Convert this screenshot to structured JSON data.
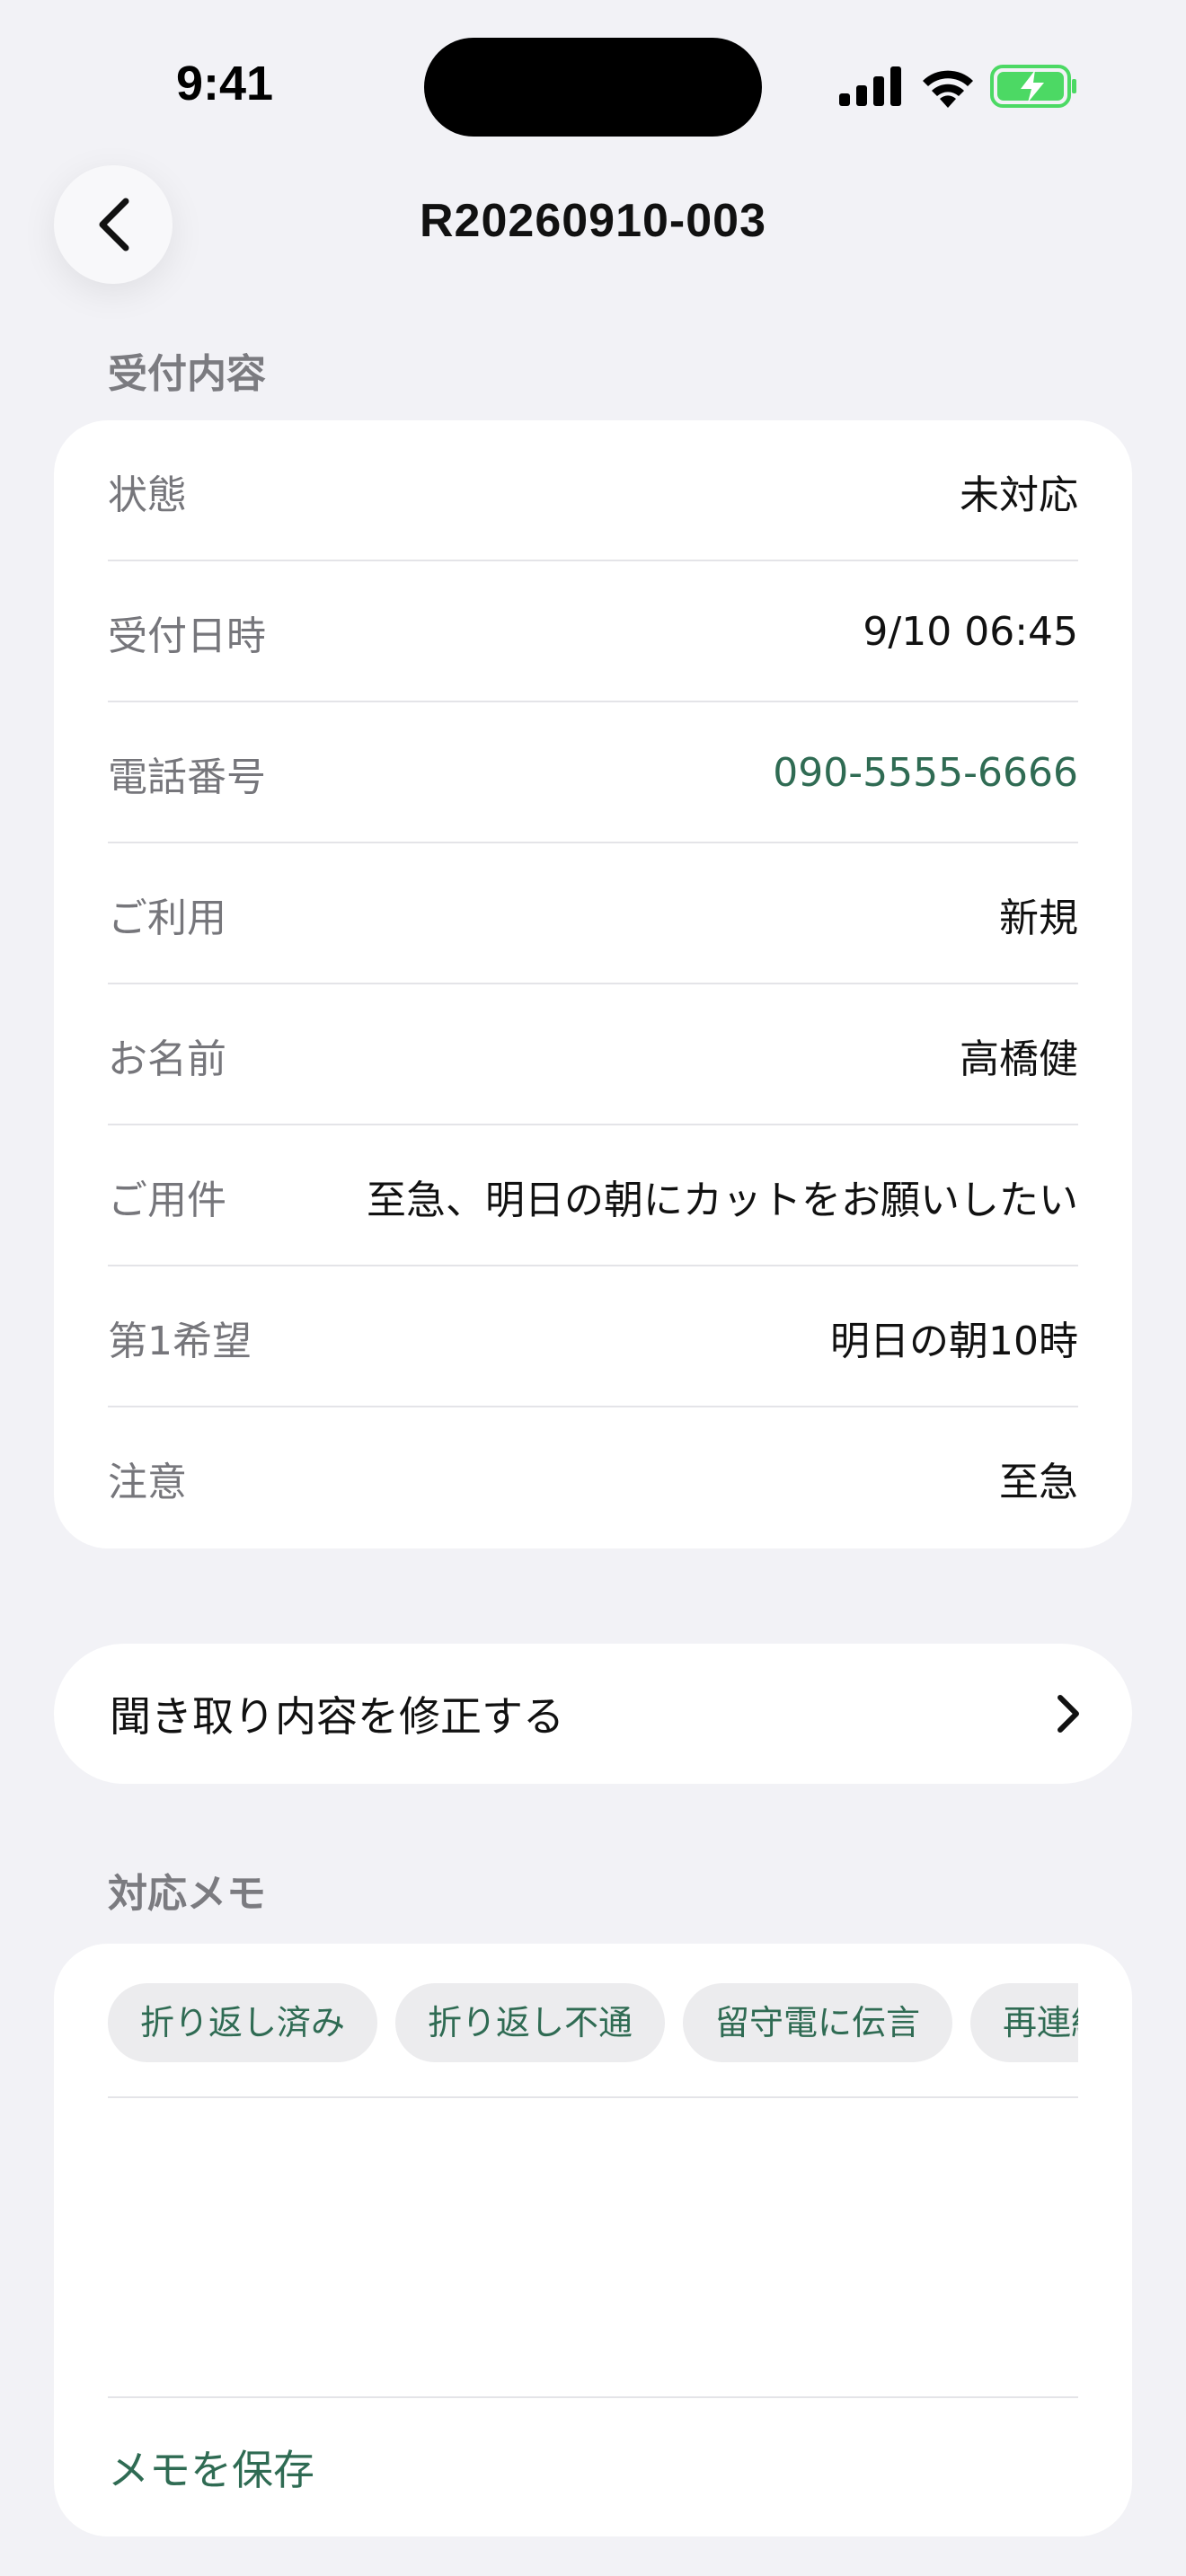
{
  "status_bar": {
    "time": "9:41"
  },
  "nav": {
    "title": "R20260910-003",
    "back_icon": "chevron-left-icon"
  },
  "reception": {
    "header": "受付内容",
    "rows": [
      {
        "label": "状態",
        "value": "未対応"
      },
      {
        "label": "受付日時",
        "value": "9/10 06:45"
      },
      {
        "label": "電話番号",
        "value": "090-5555-6666"
      },
      {
        "label": "ご利用",
        "value": "新規"
      },
      {
        "label": "お名前",
        "value": "高橋健"
      },
      {
        "label": "ご用件",
        "value": "至急、明日の朝にカットをお願いしたい"
      },
      {
        "label": "第1希望",
        "value": "明日の朝10時"
      },
      {
        "label": "注意",
        "value": "至急"
      }
    ]
  },
  "edit_button": {
    "label": "聞き取り内容を修正する",
    "icon": "chevron-right-icon"
  },
  "memo": {
    "header": "対応メモ",
    "chips": [
      "折り返し済み",
      "折り返し不通",
      "留守電に伝言",
      "再連絡"
    ],
    "text": "",
    "save_label": "メモを保存"
  },
  "colors": {
    "background": "#f2f2f6",
    "accent": "#2f6b53",
    "battery": "#4cd964"
  }
}
